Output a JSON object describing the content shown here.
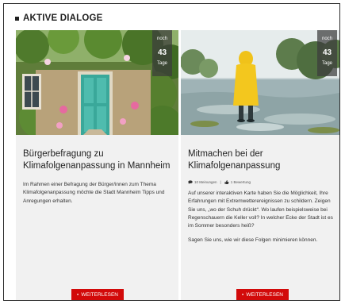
{
  "section": {
    "title": "AKTIVE DIALOGE"
  },
  "cards": [
    {
      "countdown": {
        "pre": "noch",
        "days": "43",
        "post": "Tage"
      },
      "title": "Bürgerbefragung zu Klimafolgenanpassung in Mannheim",
      "paragraphs": [
        "Im Rahmen einer Befragung der Bürger/innen zum Thema Klimafolgenanpassung möchte die Stadt Mannheim Tipps und Anregungen erhalten."
      ],
      "button_label": "WEITERLESEN",
      "photo_icon": "door-garden-photo"
    },
    {
      "countdown": {
        "pre": "noch",
        "days": "43",
        "post": "Tage"
      },
      "title": "Mitmachen bei der Klimafolgenanpassung",
      "meta": {
        "comments": "10 Meinungen",
        "ratings": "1 Bewertung"
      },
      "paragraphs": [
        "Auf unserer interaktiven Karte haben Sie die Möglichkeit, Ihre Erfahrungen mit Extremwetterereignissen zu schildern. Zeigen Sie uns, „wo der Schuh drückt“. Wo laufen beispielsweise bei Regenschauern die Keller voll? In welcher Ecke der Stadt ist es im Sommer besonders heiß?",
        "Sagen Sie uns, wie wir diese Folgen minimieren können."
      ],
      "button_label": "WEITERLESEN",
      "photo_icon": "flood-person-photo"
    }
  ],
  "colors": {
    "button": "#d20a0a",
    "card_bg": "#f1f1f1",
    "overlay": "#3c3c3c"
  }
}
